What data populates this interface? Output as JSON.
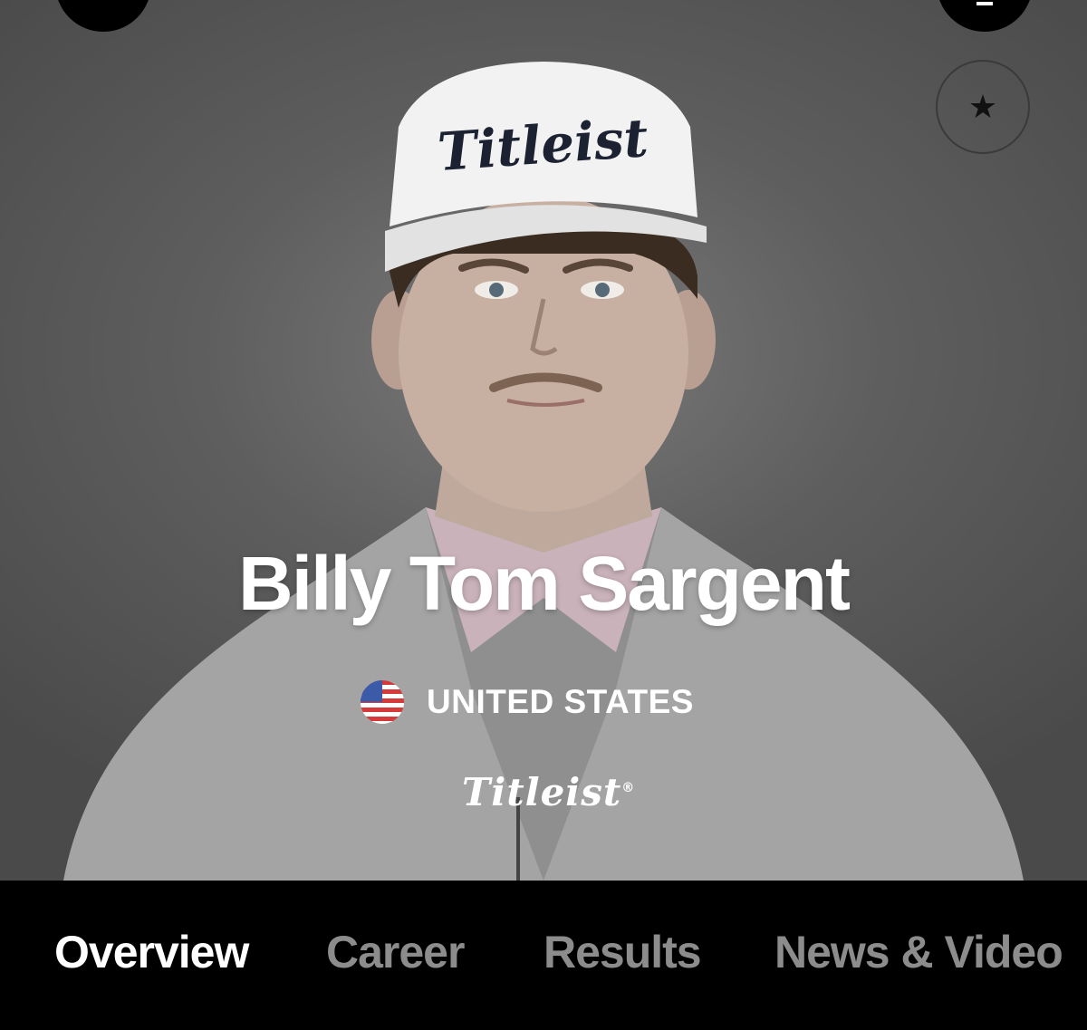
{
  "player": {
    "name": "Billy Tom Sargent",
    "country": "UNITED STATES",
    "sponsor": "Titleist",
    "sponsor_mark": "®"
  },
  "icons": {
    "favorite": "star-icon",
    "country_flag": "us-flag-icon",
    "menu": "menu-icon"
  },
  "tabs": [
    {
      "label": "Overview",
      "active": true
    },
    {
      "label": "Career",
      "active": false
    },
    {
      "label": "Results",
      "active": false
    },
    {
      "label": "News & Video",
      "active": false
    }
  ],
  "colors": {
    "background": "#000000",
    "hero_gray": "#5e5e5e",
    "text_active": "#ffffff",
    "text_inactive": "#8c8c8c"
  }
}
